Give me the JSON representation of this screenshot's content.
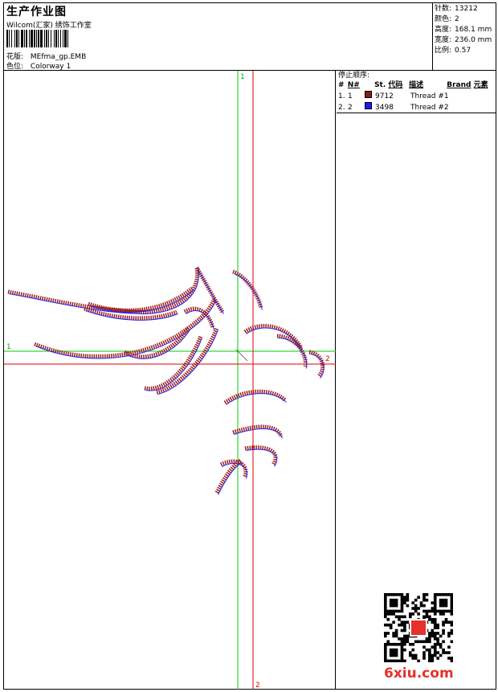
{
  "header": {
    "title": "生产作业图",
    "company": "Wilcom(汇家) 绣饰工作室",
    "design_label": "花版:",
    "design_value": "MEfma_gp.EMB",
    "colorway_label": "色位:",
    "colorway_value": "Colorway 1"
  },
  "stats": {
    "stitches_label": "针数:",
    "stitches_value": "13212",
    "colors_label": "颜色:",
    "colors_value": "2",
    "height_label": "高度:",
    "height_value": "168.1 mm",
    "width_label": "宽度:",
    "width_value": "236.0 mm",
    "scale_label": "比例:",
    "scale_value": "0.57"
  },
  "thread_panel": {
    "title": "停止顺序:",
    "headers": {
      "index": "#",
      "needle": "N#",
      "st": "St.",
      "code": "代码",
      "desc": "描述",
      "brand": "Brand",
      "element": "元素"
    },
    "rows": [
      {
        "index": "1.",
        "needle": "1",
        "color": "#8b1a1a",
        "code": "9712",
        "desc": "Thread #1"
      },
      {
        "index": "2.",
        "needle": "2",
        "color": "#1a1aff",
        "code": "3498",
        "desc": "Thread #2"
      }
    ]
  },
  "guides": {
    "green_top": "1",
    "green_left": "1",
    "red_right": "2",
    "red_bottom": "2"
  },
  "colors": {
    "green_guide": "#00cc00",
    "red_guide": "#e00000",
    "stitch_red": "#a0201a",
    "stitch_blue": "#2222ff"
  },
  "watermark": "6xiu.com"
}
